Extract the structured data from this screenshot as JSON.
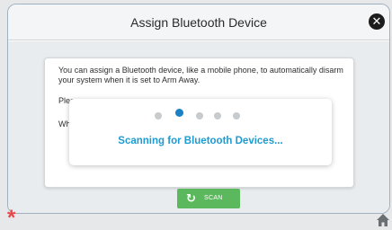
{
  "dialog": {
    "title": "Assign Bluetooth Device",
    "close_icon": "close-icon"
  },
  "card": {
    "paragraph_1": "You can assign a Bluetooth device, like a mobile phone, to automatically disarm your system when it is set to Arm Away.",
    "paragraph_2": "Pleas",
    "paragraph_3": "Wher"
  },
  "scanning": {
    "message": "Scanning for Bluetooth Devices...",
    "dot_count": 5,
    "active_dot": 2,
    "accent_color": "#1a82c4"
  },
  "scan_button": {
    "icon": "refresh-icon",
    "label": "SCAN",
    "color": "#5cb85c"
  },
  "footer": {
    "left_icon": "asterisk-icon",
    "right_icon": "home-icon"
  }
}
